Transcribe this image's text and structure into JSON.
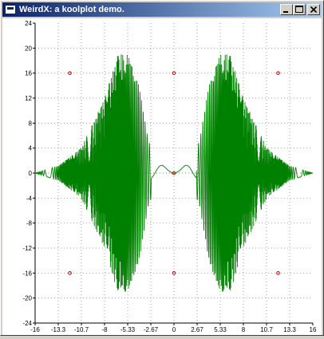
{
  "window": {
    "title": "WeirdX:  a koolplot demo.",
    "icon": "weirdx-app-icon",
    "controls": [
      "minimize-icon",
      "maximize-icon",
      "close-icon"
    ]
  },
  "chart_data": {
    "type": "line",
    "title": "",
    "xlabel": "",
    "ylabel": "",
    "xlim": [
      -16,
      16
    ],
    "ylim": [
      -24,
      24
    ],
    "grid": true,
    "x_ticks": [
      "-16",
      "-13.3",
      "-10.7",
      "-8",
      "-5.33",
      "-2.67",
      "0",
      "2.67",
      "5.33",
      "8",
      "10.7",
      "13.3",
      "16"
    ],
    "y_ticks": [
      "24",
      "20",
      "16",
      "12",
      "8",
      "4",
      "0",
      "-4",
      "-8",
      "-12",
      "-16",
      "-20",
      "-24"
    ],
    "series": [
      {
        "color": "#008000",
        "description_points": [
          {
            "x": -16,
            "y": 0
          },
          {
            "x": -13.3,
            "y": 1.2
          },
          {
            "x": -10.7,
            "y": 4
          },
          {
            "x": -8,
            "y": 12
          },
          {
            "x": -6.5,
            "y": 19
          },
          {
            "x": -5.33,
            "y": 19
          },
          {
            "x": -4.0,
            "y": 14
          },
          {
            "x": -3.0,
            "y": -5.5
          },
          {
            "x": -2.0,
            "y": 1.8
          },
          {
            "x": -1.0,
            "y": 1.0
          },
          {
            "x": 0,
            "y": 0
          },
          {
            "x": 1.0,
            "y": 1.0
          },
          {
            "x": 2.0,
            "y": 1.8
          },
          {
            "x": 3.0,
            "y": -5.5
          },
          {
            "x": 4.0,
            "y": 14
          },
          {
            "x": 5.33,
            "y": 19
          },
          {
            "x": 6.5,
            "y": 19
          },
          {
            "x": 8,
            "y": 12
          },
          {
            "x": 10.7,
            "y": 4
          },
          {
            "x": 13.3,
            "y": 1.2
          },
          {
            "x": 16,
            "y": 0
          }
        ]
      }
    ],
    "markers": {
      "color": "#c00000",
      "points": [
        {
          "x": -12,
          "y": 16
        },
        {
          "x": 0,
          "y": 16
        },
        {
          "x": 12,
          "y": 16
        },
        {
          "x": -12,
          "y": -16
        },
        {
          "x": 0,
          "y": -16
        },
        {
          "x": 12,
          "y": -16
        },
        {
          "x": 0,
          "y": 0
        }
      ]
    }
  }
}
